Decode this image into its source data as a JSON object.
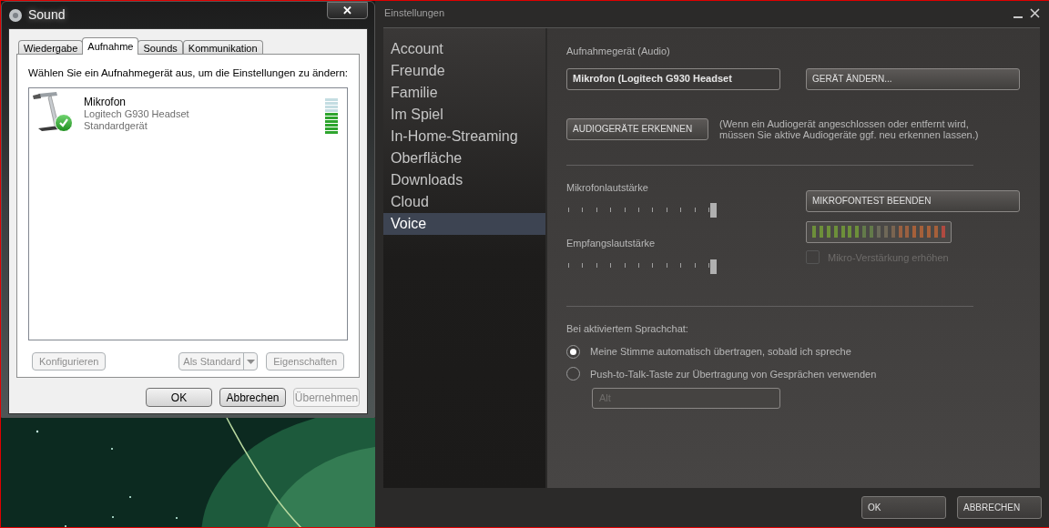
{
  "sound_window": {
    "title": "Sound",
    "close": "✕",
    "tabs": [
      {
        "label": "Wiedergabe",
        "selected": false
      },
      {
        "label": "Aufnahme",
        "selected": true
      },
      {
        "label": "Sounds",
        "selected": false
      },
      {
        "label": "Kommunikation",
        "selected": false
      }
    ],
    "instruction": "Wählen Sie ein Aufnahmegerät aus, um die Einstellungen zu ändern:",
    "devices": [
      {
        "name": "Mikrofon",
        "description": "Logitech G930 Headset",
        "status": "Standardgerät",
        "default": true,
        "level": 0.6
      }
    ],
    "device_buttons": [
      {
        "label": "Konfigurieren",
        "kind": "plain",
        "disabled": true
      },
      {
        "label": "Als Standard",
        "kind": "split",
        "disabled": true
      },
      {
        "label": "Eigenschaften",
        "kind": "plain",
        "disabled": true
      }
    ],
    "dialog_buttons": [
      {
        "label": "OK",
        "disabled": false
      },
      {
        "label": "Abbrechen",
        "disabled": false
      },
      {
        "label": "Übernehmen",
        "disabled": true
      }
    ]
  },
  "settings_window": {
    "title": "Einstellungen",
    "sidebar": {
      "items": [
        {
          "label": "Account",
          "selected": false
        },
        {
          "label": "Freunde",
          "selected": false
        },
        {
          "label": "Familie",
          "selected": false
        },
        {
          "label": "Im Spiel",
          "selected": false
        },
        {
          "label": "In-Home-Streaming",
          "selected": false
        },
        {
          "label": "Oberfläche",
          "selected": false
        },
        {
          "label": "Downloads",
          "selected": false
        },
        {
          "label": "Cloud",
          "selected": false
        },
        {
          "label": "Voice",
          "selected": true
        }
      ]
    },
    "recording_device": {
      "label": "Aufnahmegerät (Audio)",
      "value": "Mikrofon (Logitech G930 Headset",
      "change_button": "GERÄT ÄNDERN..."
    },
    "detect_button": "AUDIOGERÄTE ERKENNEN",
    "detect_note": "(Wenn ein Audiogerät angeschlossen oder entfernt wird,\nmüssen Sie aktive Audiogeräte ggf. neu erkennen lassen.)",
    "mic_volume": {
      "label": "Mikrofonlautstärke",
      "level": 1.0
    },
    "mic_test_button": "MIKROFONTEST BEENDEN",
    "receive_volume": {
      "label": "Empfangslautstärke",
      "level": 1.0
    },
    "mic_boost": {
      "label": "Mikro-Verstärkung erhöhen",
      "checked": false,
      "disabled": true
    },
    "voice_chat": {
      "label": "Bei aktiviertem Sprachchat:",
      "options": [
        {
          "label": "Meine Stimme automatisch übertragen, sobald ich spreche",
          "selected": true
        },
        {
          "label": "Push-to-Talk-Taste zur Übertragung von Gesprächen verwenden",
          "selected": false
        }
      ],
      "push_to_talk_key": {
        "value": "Alt",
        "disabled": true
      }
    },
    "buttons": [
      "OK",
      "ABBRECHEN"
    ]
  }
}
